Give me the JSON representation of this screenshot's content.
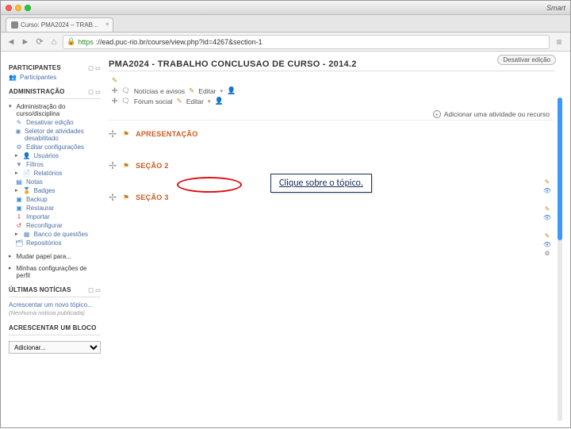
{
  "os": {
    "window_right_label": "Smart"
  },
  "browser": {
    "tab_title": "Curso: PMA2024 – TRAB...",
    "url_scheme": "https",
    "url_rest": "://ead.puc-rio.br/course/view.php?id=4267&section-1"
  },
  "page_header": {
    "edit_button": "Desativar edição"
  },
  "sidebar": {
    "participants": {
      "title": "PARTICIPANTES",
      "item": "Participantes"
    },
    "admin": {
      "title": "ADMINISTRAÇÃO",
      "root": "Administração do curso/disciplina",
      "items": [
        "Desativar edição",
        "Seletor de atividades desabilitado",
        "Editar configurações",
        "Usuários",
        "Filtros",
        "Relatórios",
        "Notas",
        "Badges",
        "Backup",
        "Restaurar",
        "Importar",
        "Reconfigurar",
        "Banco de questões",
        "Repositórios"
      ],
      "switch_role": "Mudar papel para...",
      "my_profile": "Minhas configurações de perfil"
    },
    "news": {
      "title": "ÚLTIMAS NOTÍCIAS",
      "add": "Acrescentar um novo tópico...",
      "empty": "(Nenhuma notícia publicada)"
    },
    "addblock": {
      "title": "ACRESCENTAR UM BLOCO",
      "placeholder": "Adicionar..."
    }
  },
  "course": {
    "title": "PMA2024 - TRABALHO CONCLUSAO DE CURSO - 2014.2",
    "forum1": {
      "name": "Notícias e avisos",
      "edit": "Editar"
    },
    "forum2": {
      "name": "Fórum social",
      "edit": "Editar"
    },
    "add_activity": "Adicionar uma atividade ou recurso",
    "sections": [
      {
        "label": "APRESENTAÇÃO"
      },
      {
        "label": "SEÇÃO 2"
      },
      {
        "label": "SEÇÃO 3"
      }
    ]
  },
  "annotation": {
    "text": "Clique sobre o tópico."
  }
}
